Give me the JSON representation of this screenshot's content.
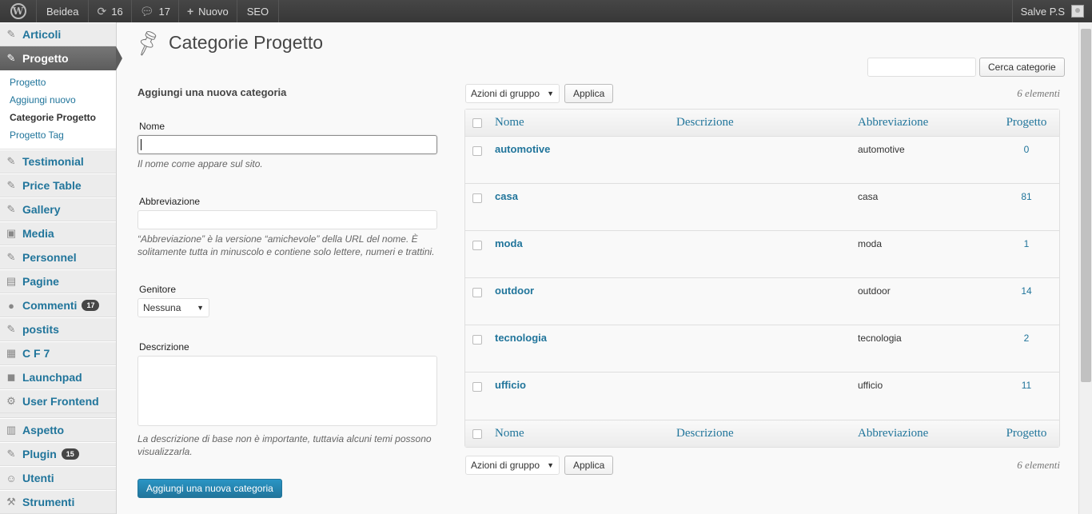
{
  "adminbar": {
    "site_name": "Beidea",
    "updates_count": "16",
    "comments_count": "17",
    "new_label": "Nuovo",
    "seo_label": "SEO",
    "greeting": "Salve P.S"
  },
  "sidebar": {
    "items": [
      {
        "label": "Articoli",
        "icon": "pin-icon"
      },
      {
        "label": "Progetto",
        "icon": "pin-icon",
        "current": true
      },
      {
        "label": "Testimonial",
        "icon": "pin-icon"
      },
      {
        "label": "Price Table",
        "icon": "pin-icon"
      },
      {
        "label": "Gallery",
        "icon": "pin-icon"
      },
      {
        "label": "Media",
        "icon": "media-icon"
      },
      {
        "label": "Personnel",
        "icon": "pin-icon"
      },
      {
        "label": "Pagine",
        "icon": "page-icon"
      },
      {
        "label": "Commenti",
        "icon": "comment-icon",
        "badge": "17"
      },
      {
        "label": "postits",
        "icon": "pin-icon"
      },
      {
        "label": "C F 7",
        "icon": "cf7-icon"
      },
      {
        "label": "Launchpad",
        "icon": "launchpad-icon"
      },
      {
        "label": "User Frontend",
        "icon": "gear-icon"
      },
      {
        "label": "Aspetto",
        "icon": "appearance-icon"
      },
      {
        "label": "Plugin",
        "icon": "plugin-icon",
        "badge": "15"
      },
      {
        "label": "Utenti",
        "icon": "users-icon"
      },
      {
        "label": "Strumenti",
        "icon": "tools-icon"
      }
    ],
    "submenu": [
      "Progetto",
      "Aggiungi nuovo",
      "Categorie Progetto",
      "Progetto Tag"
    ]
  },
  "page": {
    "title": "Categorie Progetto",
    "search_button": "Cerca categorie"
  },
  "form": {
    "title": "Aggiungi una nuova categoria",
    "name_label": "Nome",
    "name_help": "Il nome come appare sul sito.",
    "slug_label": "Abbreviazione",
    "slug_help": "“Abbreviazione” è la versione “amichevole” della URL del nome. È solitamente tutta in minuscolo e contiene solo lettere, numeri e trattini.",
    "parent_label": "Genitore",
    "parent_value": "Nessuna",
    "desc_label": "Descrizione",
    "desc_help": "La descrizione di base non è importante, tuttavia alcuni temi possono visualizzarla.",
    "submit": "Aggiungi una nuova categoria"
  },
  "table": {
    "bulk_actions": "Azioni di gruppo",
    "apply": "Applica",
    "count": "6 elementi",
    "columns": [
      "Nome",
      "Descrizione",
      "Abbreviazione",
      "Progetto"
    ],
    "rows": [
      {
        "name": "automotive",
        "description": "",
        "slug": "automotive",
        "count": "0"
      },
      {
        "name": "casa",
        "description": "",
        "slug": "casa",
        "count": "81"
      },
      {
        "name": "moda",
        "description": "",
        "slug": "moda",
        "count": "1"
      },
      {
        "name": "outdoor",
        "description": "",
        "slug": "outdoor",
        "count": "14"
      },
      {
        "name": "tecnologia",
        "description": "",
        "slug": "tecnologia",
        "count": "2"
      },
      {
        "name": "ufficio",
        "description": "",
        "slug": "ufficio",
        "count": "11"
      }
    ]
  }
}
